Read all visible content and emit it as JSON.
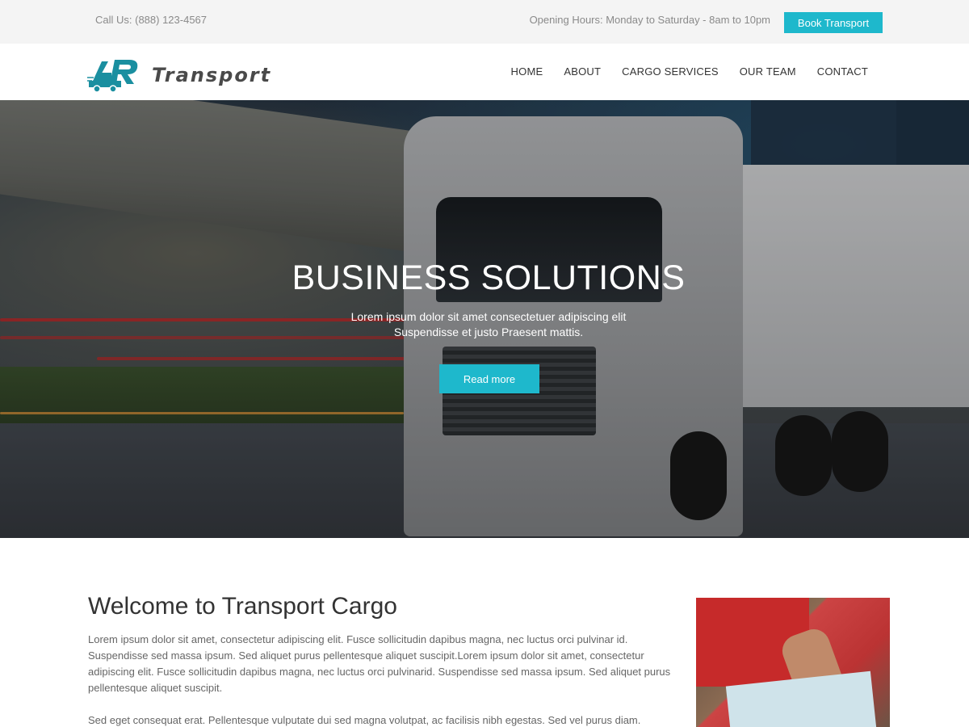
{
  "topbar": {
    "call": "Call Us: (888) 123-4567",
    "hours": "Opening Hours: Monday to Saturday - 8am to 10pm",
    "book_label": "Book Transport"
  },
  "header": {
    "logo_text": "Transport",
    "nav": [
      "HOME",
      "ABOUT",
      "CARGO SERVICES",
      "OUR TEAM",
      "CONTACT"
    ]
  },
  "hero": {
    "title": "BUSINESS SOLUTIONS",
    "subtitle_line1": "Lorem ipsum dolor sit amet consectetuer adipiscing elit",
    "subtitle_line2": "Suspendisse et justo Praesent mattis.",
    "button_label": "Read more"
  },
  "welcome": {
    "title": "Welcome to  Transport Cargo",
    "paragraph1": "Lorem ipsum dolor sit amet, consectetur adipiscing elit. Fusce sollicitudin dapibus magna, nec luctus orci pulvinar id. Suspendisse sed massa ipsum. Sed aliquet purus pellentesque aliquet suscipit.Lorem ipsum dolor sit amet, consectetur adipiscing elit. Fusce sollicitudin dapibus magna, nec luctus orci pulvinarid. Suspendisse sed massa ipsum. Sed aliquet purus pellentesque aliquet suscipit.",
    "paragraph2": "Sed eget consequat erat. Pellentesque vulputate dui sed magna volutpat, ac facilisis nibh egestas. Sed vel purus diam. Praesent"
  },
  "colors": {
    "accent": "#1eb8cc",
    "topbar_bg": "#f4f4f4",
    "logo_icon": "#1a8fa0"
  },
  "icons": {
    "logo": "truck-logo-icon"
  }
}
